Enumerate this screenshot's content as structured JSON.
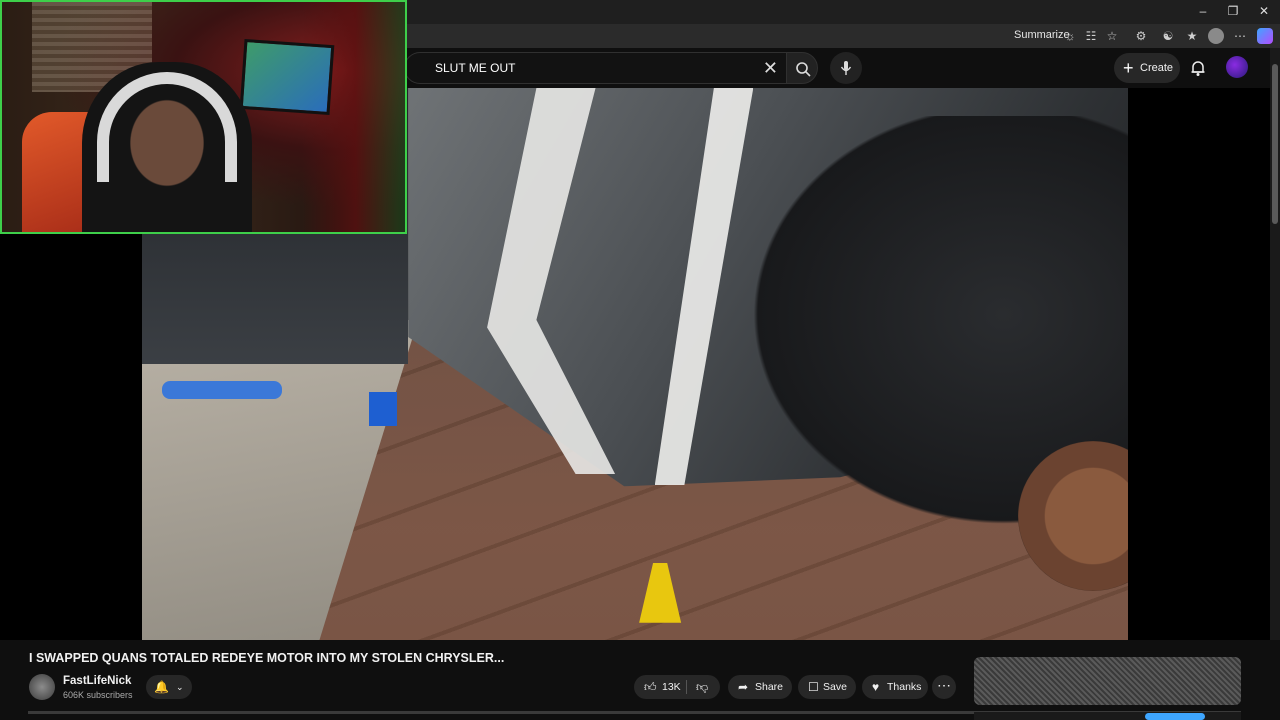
{
  "browser": {
    "summarize_label": "Summarize",
    "window_controls": [
      "minimize",
      "maximize",
      "close"
    ]
  },
  "masthead": {
    "search_query": "SLUT ME OUT",
    "create_label": "Create",
    "icons": [
      "close-icon",
      "search-icon",
      "microphone-icon",
      "plus-icon",
      "bell-icon"
    ]
  },
  "video": {
    "title": "I SWAPPED QUANS TOTALED REDEYE MOTOR INTO MY STOLEN CHRYSLER...",
    "channel_name": "FastLifeNick",
    "subscribers": "606K subscribers",
    "like_count": "13K",
    "actions": {
      "share": "Share",
      "save": "Save",
      "thanks": "Thanks"
    }
  },
  "colors": {
    "background": "#0f0f0f",
    "pill": "#272727",
    "webcam_border": "#3ecf4a",
    "accent": "#3ea6ff"
  }
}
